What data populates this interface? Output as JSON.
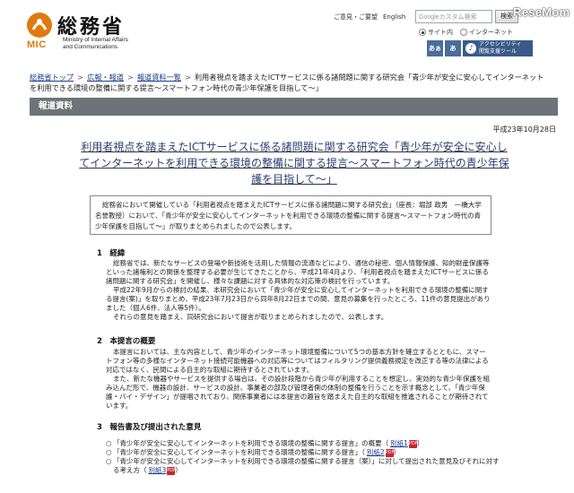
{
  "header": {
    "mic_label": "MIC",
    "site_title": "総務省",
    "subtitle_line1": "Ministry of Internal Affairs",
    "subtitle_line2": "and Communications",
    "links": [
      "ご意見・ご要望",
      "English"
    ],
    "search_placeholder": "Googleカスタム検索",
    "search_button": "検索",
    "radio_options": [
      "サイト内",
      "インターネット"
    ],
    "radio_selected": "サイト内",
    "accessibility": {
      "btn1": "あぁ",
      "btn2": "あ",
      "tool_line1": "アクセシビリティ",
      "tool_line2": "閲覧支援ツール"
    },
    "watermark": "ReseMom"
  },
  "breadcrumb": {
    "items": [
      "総務省トップ",
      "広報・報道",
      "報道資料一覧"
    ],
    "separator": ">",
    "current": "利用者視点を踏まえたICTサービスに係る諸問題に関する研究会「青少年が安全に安心してインターネットを利用できる環境の整備に関する提言〜スマートフォン時代の青少年保護を目指して〜」"
  },
  "section_label": "報道資料",
  "date": "平成23年10月28日",
  "doc_title": "利用者視点を踏まえたICTサービスに係る諸問題に関する研究会「青少年が安全に安心してインターネットを利用できる環境の整備に関する提言〜スマートフォン時代の青少年保護を目指して〜」",
  "intro": "総務省において開催している「利用者視点を踏まえたICTサービスに係る諸問題に関する研究会」（座長：堀部 政男　一橋大学名誉教授）において、「青少年が安全に安心してインターネットを利用できる環境の整備に関する提言〜スマートフォン時代の青少年保護を目指して〜」が取りまとめられましたので公表します。",
  "sections": [
    {
      "heading": "1　経緯",
      "paragraphs": [
        "総務省では、新たなサービスの登場や新技術を活用した情報の流通などにより、通信の秘密、個人情報保護、知的財産保護等といった諸権利との関係を整理する必要が生じてきたことから、平成21年4月より、「利用者視点を踏まえたICTサービスに係る諸問題に関する研究会」を開催し、様々な課題に対する具体的な対応策の検討を行っています。",
        "平成22年9月からの検討の結果、本研究会において「青少年が安全に安心してインターネットを利用できる環境の整備に関する提言(案)」を取りまとめ、平成23年7月23日から同年8月22日までの間、意見の募集を行ったところ、11件の意見提出がありました（個人6件、法人等5件）。",
        "それらの意見を踏まえ、同研究会において提言が取りまとめられましたので、公表します。"
      ]
    },
    {
      "heading": "2　本提言の概要",
      "paragraphs": [
        "本提言においては、主な内容として、青少年のインターネット環境整備について5つの基本方針を確立するとともに、スマートフォン等の多様なインターネット接続可能機器への対応等についてはフィルタリング提供義務規定を改正する等の法律による対応ではなく、民間による自主的な取組に期待するとされています。",
        "また、新たな機器やサービスを提供する場合は、その設計段階から青少年が利用することを想定し、実効的な青少年保護を組み込んだ形で、機器の設計、サービスの設計、事業者の部及び管理者側の体制の整備を行うことを示す概念として、「青少年保護・バイ・デザイン」が提唱されており、関係事業者には本提言の趣旨を踏まえた自主的な取組を推進されることが期待されています。"
      ]
    },
    {
      "heading": "3　報告書及び提出された意見",
      "paragraphs": []
    }
  ],
  "references": [
    {
      "text": "「青少年が安全に安心してインターネットを利用できる環境の整備に関する提言」の概要",
      "link": "別紙1"
    },
    {
      "text": "「青少年が安全に安心してインターネットを利用できる環境の整備に関する提言」",
      "link": "別紙2"
    },
    {
      "text": "「青少年が安全に安心してインターネットを利用できる環境の整備に関する提言（案）」に対して提出された意見及びそれに対する考え方",
      "link": "別紙3"
    }
  ],
  "pdf_label": "PDF",
  "colors": {
    "mic_orange": "#e07a10",
    "link_blue": "#1a3d8a",
    "section_bar": "#6d7378",
    "title_blue": "#2a3e6e"
  }
}
